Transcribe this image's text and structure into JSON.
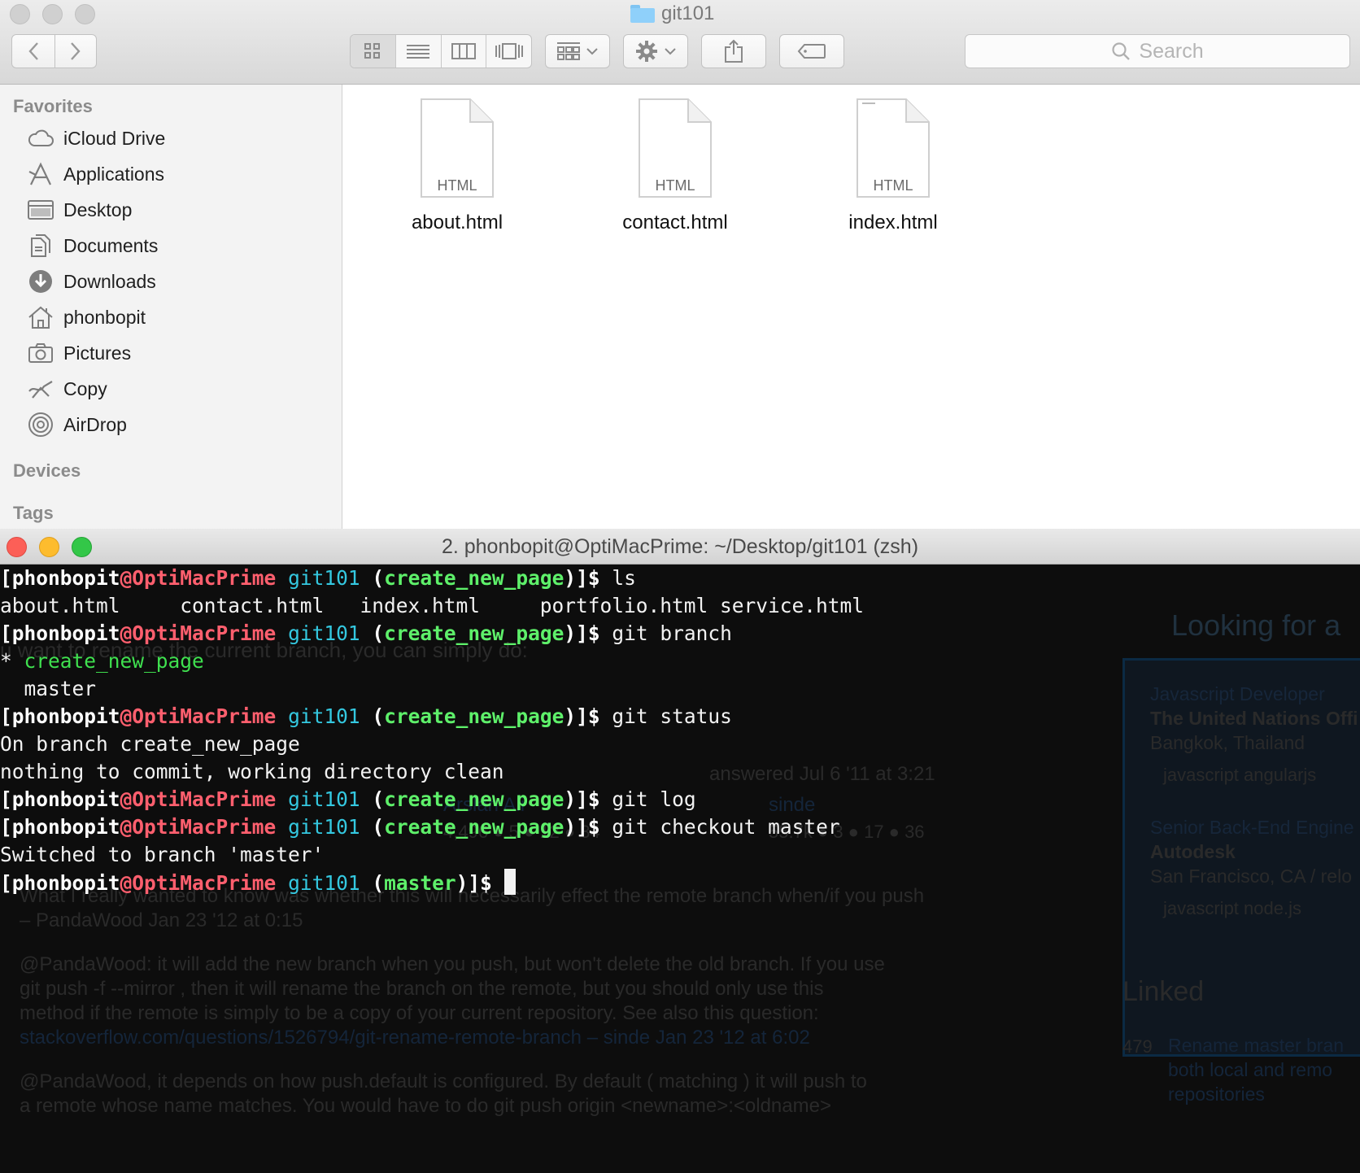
{
  "finder": {
    "title": "git101",
    "search_placeholder": "Search",
    "sidebar": {
      "favorites_header": "Favorites",
      "items": [
        {
          "label": "iCloud Drive",
          "icon": "cloud-icon"
        },
        {
          "label": "Applications",
          "icon": "applications-icon"
        },
        {
          "label": "Desktop",
          "icon": "desktop-icon"
        },
        {
          "label": "Documents",
          "icon": "documents-icon"
        },
        {
          "label": "Downloads",
          "icon": "downloads-icon"
        },
        {
          "label": "phonbopit",
          "icon": "home-icon"
        },
        {
          "label": "Pictures",
          "icon": "camera-icon"
        },
        {
          "label": "Copy",
          "icon": "copy-icon"
        },
        {
          "label": "AirDrop",
          "icon": "airdrop-icon"
        }
      ],
      "devices_header": "Devices",
      "tags_header": "Tags"
    },
    "files": [
      {
        "name": "about.html",
        "type_label": "HTML"
      },
      {
        "name": "contact.html",
        "type_label": "HTML"
      },
      {
        "name": "index.html",
        "type_label": "HTML"
      }
    ]
  },
  "terminal": {
    "title": "2. phonbopit@OptiMacPrime: ~/Desktop/git101 (zsh)",
    "prompt": {
      "user": "[phonbopit",
      "at": "@",
      "host": "OptiMacPrime",
      "dir": "git101",
      "open": "(",
      "close": ")]$"
    },
    "lines": [
      {
        "kind": "prompt",
        "branch": "create_new_page",
        "cmd": " ls"
      },
      {
        "kind": "output",
        "text": "about.html     contact.html   index.html     portfolio.html service.html"
      },
      {
        "kind": "prompt",
        "branch": "create_new_page",
        "cmd": " git branch"
      },
      {
        "kind": "current-branch",
        "text": "* ",
        "branch": "create_new_page"
      },
      {
        "kind": "output",
        "text": "  master"
      },
      {
        "kind": "prompt",
        "branch": "create_new_page",
        "cmd": " git status"
      },
      {
        "kind": "output",
        "text": "On branch create_new_page"
      },
      {
        "kind": "output",
        "text": "nothing to commit, working directory clean"
      },
      {
        "kind": "prompt",
        "branch": "create_new_page",
        "cmd": " git log"
      },
      {
        "kind": "prompt",
        "branch": "create_new_page",
        "cmd": " git checkout master"
      },
      {
        "kind": "output",
        "text": "Switched to branch 'master'"
      },
      {
        "kind": "prompt",
        "branch": "master",
        "cmd": " ",
        "cursor": true
      }
    ]
  },
  "background_page": {
    "rename_hint": "u want to rename the current branch, you can simply do:",
    "answered": "answered Jul 6 '11 at 3:21",
    "user1": "Arslan Ali",
    "user1_rep": "4,496 ● 5 ● 12 ● 34",
    "user2": "sinde",
    "user2_rep": "55.7k ● 3 ● 17 ● 36",
    "comment1": "What I really wanted to know was whether this will necessarily effect the remote branch when/if you push",
    "comment1_by": "– PandaWood Jan 23 '12 at 0:15",
    "comment2a": "@PandaWood: it will add the new branch when you push, but won't delete the old branch. If you use",
    "comment2b": " git push -f --mirror , then it will rename the branch on the remote, but you should only use this",
    "comment2c": "method if the remote is simply to be a copy of your current repository. See also this question:",
    "comment2d": "stackoverflow.com/questions/1526794/git-rename-remote-branch – sinde Jan 23 '12 at 6:02",
    "comment3a": "@PandaWood, it depends on how push.default is configured. By default ( matching ) it will push to",
    "comment3b": "a remote whose name matches. You would have to do git push origin <newname>:<oldname>",
    "jobs_title": "Looking for a",
    "job1_title": "Javascript Developer",
    "job1_company": "The United Nations Offi",
    "job1_location": "Bangkok, Thailand",
    "job1_tags": "javascript   angularjs",
    "job2_title": "Senior Back-End Engine",
    "job2_company": "Autodesk",
    "job2_location": "San Francisco, CA / relo",
    "job2_tags": "javascript   node.js",
    "linked_title": "Linked",
    "linked_count": "479",
    "linked_item": "Rename master bran both local and remo repositories"
  }
}
